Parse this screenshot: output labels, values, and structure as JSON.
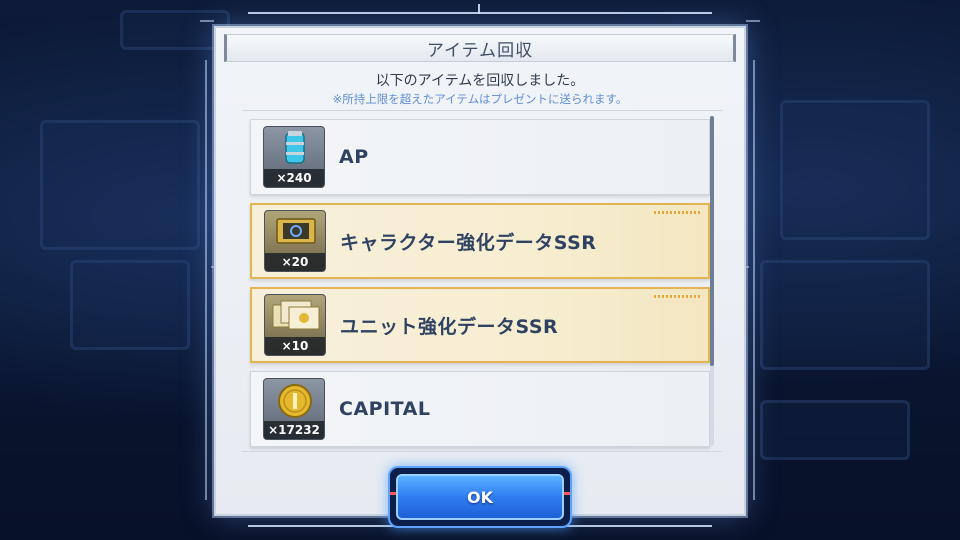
{
  "dialog": {
    "title": "アイテム回収",
    "message": "以下のアイテムを回収しました。",
    "note": "※所持上限を超えたアイテムはプレゼントに送られます。"
  },
  "items": [
    {
      "name": "AP",
      "quantity": "×240",
      "icon": "ap-canister-icon",
      "rarity": "normal"
    },
    {
      "name": "キャラクター強化データSSR",
      "quantity": "×20",
      "icon": "character-enhance-data-icon",
      "rarity": "ssr"
    },
    {
      "name": "ユニット強化データSSR",
      "quantity": "×10",
      "icon": "unit-enhance-data-icon",
      "rarity": "ssr"
    },
    {
      "name": "CAPITAL",
      "quantity": "×17232",
      "icon": "capital-coin-icon",
      "rarity": "normal"
    }
  ],
  "ok_button": {
    "label": "OK"
  },
  "colors": {
    "accent_blue": "#2f7df2",
    "ssr_gold": "#e2b552",
    "item_text": "#2f4262",
    "note_text": "#5f8fd6"
  }
}
